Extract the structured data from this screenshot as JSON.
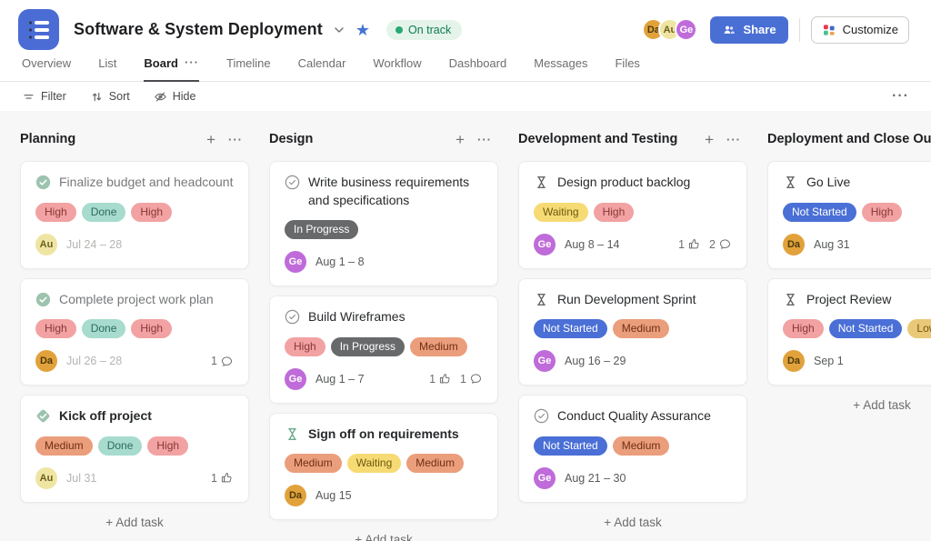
{
  "header": {
    "title": "Software & System Deployment",
    "status": "On track",
    "share": "Share",
    "customize": "Customize",
    "avatars": [
      {
        "initials": "Da"
      },
      {
        "initials": "Au"
      },
      {
        "initials": "Ge"
      }
    ]
  },
  "icons": {
    "more": "···",
    "plus": "+"
  },
  "tabs": [
    {
      "label": "Overview"
    },
    {
      "label": "List"
    },
    {
      "label": "Board",
      "active": true
    },
    {
      "label": "Timeline"
    },
    {
      "label": "Calendar"
    },
    {
      "label": "Workflow"
    },
    {
      "label": "Dashboard"
    },
    {
      "label": "Messages"
    },
    {
      "label": "Files"
    }
  ],
  "toolbar": {
    "filter": "Filter",
    "sort": "Sort",
    "hide": "Hide"
  },
  "colors": {
    "accent_blue": "#4a6fd4",
    "project_icon": "#4a6cd4",
    "board_bg": "#f7f7f7",
    "on_track_bg": "#e5f4eb",
    "on_track_text": "#0d7a52",
    "tags": {
      "high": "#f2a2a2",
      "done": "#a6dbce",
      "medium": "#eb9e7c",
      "waiting": "#f6db74",
      "low": "#e9c977",
      "in_progress": "#68696b",
      "not_started": "#4a6fd6"
    },
    "avatars": {
      "Da": "#e2a23b",
      "Au": "#efe5a3",
      "Ge": "#bf6bd9"
    },
    "done_icon": "#9dc3af"
  },
  "board": {
    "add_task_label": "Add task",
    "columns": [
      {
        "name": "Planning",
        "cards": [
          {
            "title": "Finalize budget and headcount",
            "type": "completed-task",
            "tags": [
              {
                "label": "High",
                "type": "high"
              },
              {
                "label": "Done",
                "type": "done"
              },
              {
                "label": "High",
                "type": "high"
              }
            ],
            "assignee": "Au",
            "date": "Jul 24 – 28"
          },
          {
            "title": "Complete project work plan",
            "type": "completed-task",
            "tags": [
              {
                "label": "High",
                "type": "high"
              },
              {
                "label": "Done",
                "type": "done"
              },
              {
                "label": "High",
                "type": "high"
              }
            ],
            "assignee": "Da",
            "date": "Jul 26 – 28",
            "comments": "1"
          },
          {
            "title": "Kick off project",
            "type": "completed-milestone",
            "tags": [
              {
                "label": "Medium",
                "type": "medium"
              },
              {
                "label": "Done",
                "type": "done"
              },
              {
                "label": "High",
                "type": "high"
              }
            ],
            "assignee": "Au",
            "date": "Jul 31",
            "likes": "1"
          }
        ]
      },
      {
        "name": "Design",
        "cards": [
          {
            "title": "Write business requirements and specifications",
            "type": "task",
            "tags": [
              {
                "label": "In Progress",
                "type": "inprogress"
              }
            ],
            "assignee": "Ge",
            "date": "Aug 1 – 8"
          },
          {
            "title": "Build Wireframes",
            "type": "task",
            "tags": [
              {
                "label": "High",
                "type": "high"
              },
              {
                "label": "In Progress",
                "type": "inprogress"
              },
              {
                "label": "Medium",
                "type": "medium"
              }
            ],
            "assignee": "Ge",
            "date": "Aug 1 – 7",
            "likes": "1",
            "comments": "1"
          },
          {
            "title": "Sign off on requirements",
            "type": "approval",
            "tags": [
              {
                "label": "Medium",
                "type": "medium"
              },
              {
                "label": "Waiting",
                "type": "waiting"
              },
              {
                "label": "Medium",
                "type": "medium"
              }
            ],
            "assignee": "Da",
            "date": "Aug 15"
          }
        ]
      },
      {
        "name": "Development and Testing",
        "cards": [
          {
            "title": "Design product backlog",
            "type": "approval-pending",
            "tags": [
              {
                "label": "Waiting",
                "type": "waiting"
              },
              {
                "label": "High",
                "type": "high"
              }
            ],
            "assignee": "Ge",
            "date": "Aug 8 – 14",
            "likes": "1",
            "comments": "2"
          },
          {
            "title": "Run Development Sprint",
            "type": "approval-pending",
            "tags": [
              {
                "label": "Not Started",
                "type": "notstarted"
              },
              {
                "label": "Medium",
                "type": "medium"
              }
            ],
            "assignee": "Ge",
            "date": "Aug 16 – 29"
          },
          {
            "title": "Conduct Quality Assurance",
            "type": "task",
            "tags": [
              {
                "label": "Not Started",
                "type": "notstarted"
              },
              {
                "label": "Medium",
                "type": "medium"
              }
            ],
            "assignee": "Ge",
            "date": "Aug 21 – 30"
          }
        ]
      },
      {
        "name": "Deployment and Close Out",
        "cards": [
          {
            "title": "Go Live",
            "type": "approval-pending",
            "tags": [
              {
                "label": "Not Started",
                "type": "notstarted"
              },
              {
                "label": "High",
                "type": "high"
              }
            ],
            "assignee": "Da",
            "date": "Aug 31"
          },
          {
            "title": "Project Review",
            "type": "approval-pending",
            "tags": [
              {
                "label": "High",
                "type": "high"
              },
              {
                "label": "Not Started",
                "type": "notstarted"
              },
              {
                "label": "Low",
                "type": "low"
              }
            ],
            "assignee": "Da",
            "date": "Sep 1"
          }
        ]
      }
    ]
  }
}
